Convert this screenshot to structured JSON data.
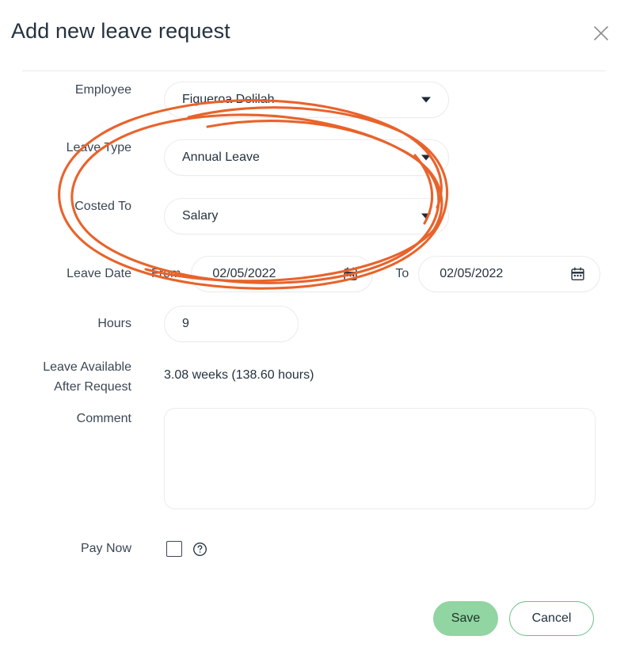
{
  "dialog": {
    "title": "Add new leave request",
    "close_icon": "close-icon"
  },
  "form": {
    "employee": {
      "label": "Employee",
      "value": "Figueroa Delilah",
      "caret_icon": "chevron-down-icon"
    },
    "leave_type": {
      "label": "Leave Type",
      "value": "Annual Leave",
      "caret_icon": "chevron-down-icon"
    },
    "costed_to": {
      "label": "Costed To",
      "value": "Salary",
      "caret_icon": "chevron-down-icon"
    },
    "leave_date": {
      "label": "Leave Date",
      "from_label": "From",
      "from_value": "02/05/2022",
      "to_label": "To",
      "to_value": "02/05/2022",
      "calendar_icon": "calendar-icon"
    },
    "hours": {
      "label": "Hours",
      "value": "9"
    },
    "leave_available": {
      "label": "Leave Available\nAfter Request",
      "value": "3.08 weeks (138.60 hours)"
    },
    "comment": {
      "label": "Comment",
      "value": "",
      "placeholder": ""
    },
    "pay_now": {
      "label": "Pay Now",
      "checked": false,
      "help_icon": "help-circle-icon"
    }
  },
  "footer": {
    "save_label": "Save",
    "cancel_label": "Cancel"
  },
  "colors": {
    "annotation": "#e8632b",
    "save_fill": "#91d5a2",
    "cancel_border": "#69c184",
    "text": "#25323f",
    "label": "#3b4754",
    "field_border": "#ececee"
  },
  "annotation": {
    "type": "hand-drawn-ellipse-highlight",
    "targets": [
      "employee",
      "leave_type",
      "costed_to"
    ]
  }
}
